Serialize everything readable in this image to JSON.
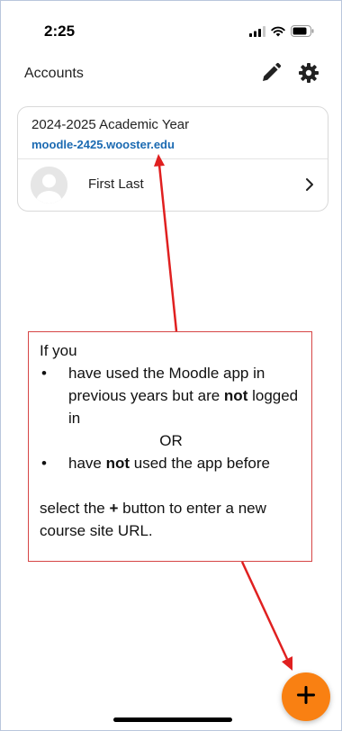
{
  "status_bar": {
    "time": "2:25",
    "icons": [
      "signal-icon",
      "wifi-icon",
      "battery-icon"
    ]
  },
  "header": {
    "title": "Accounts",
    "edit_icon": "pencil-icon",
    "settings_icon": "gear-icon"
  },
  "account": {
    "site_name": "2024-2025 Academic Year",
    "site_url": "moodle-2425.wooster.edu",
    "user_name": "First Last"
  },
  "annotation": {
    "intro": "If you",
    "bullet1_pre": "have used the Moodle app in previous years but are ",
    "bullet1_bold": "not",
    "bullet1_post": " logged in",
    "or": "OR",
    "bullet2_pre": "have ",
    "bullet2_bold": "not",
    "bullet2_post": " used the app before",
    "closing_pre": "select the ",
    "closing_bold": "+",
    "closing_post": " button to enter a new course site URL.",
    "border_color": "#d64545"
  },
  "fab": {
    "icon": "plus-icon",
    "color": "#f98012"
  },
  "colors": {
    "link": "#1b6ab2",
    "arrow": "#e02020"
  }
}
